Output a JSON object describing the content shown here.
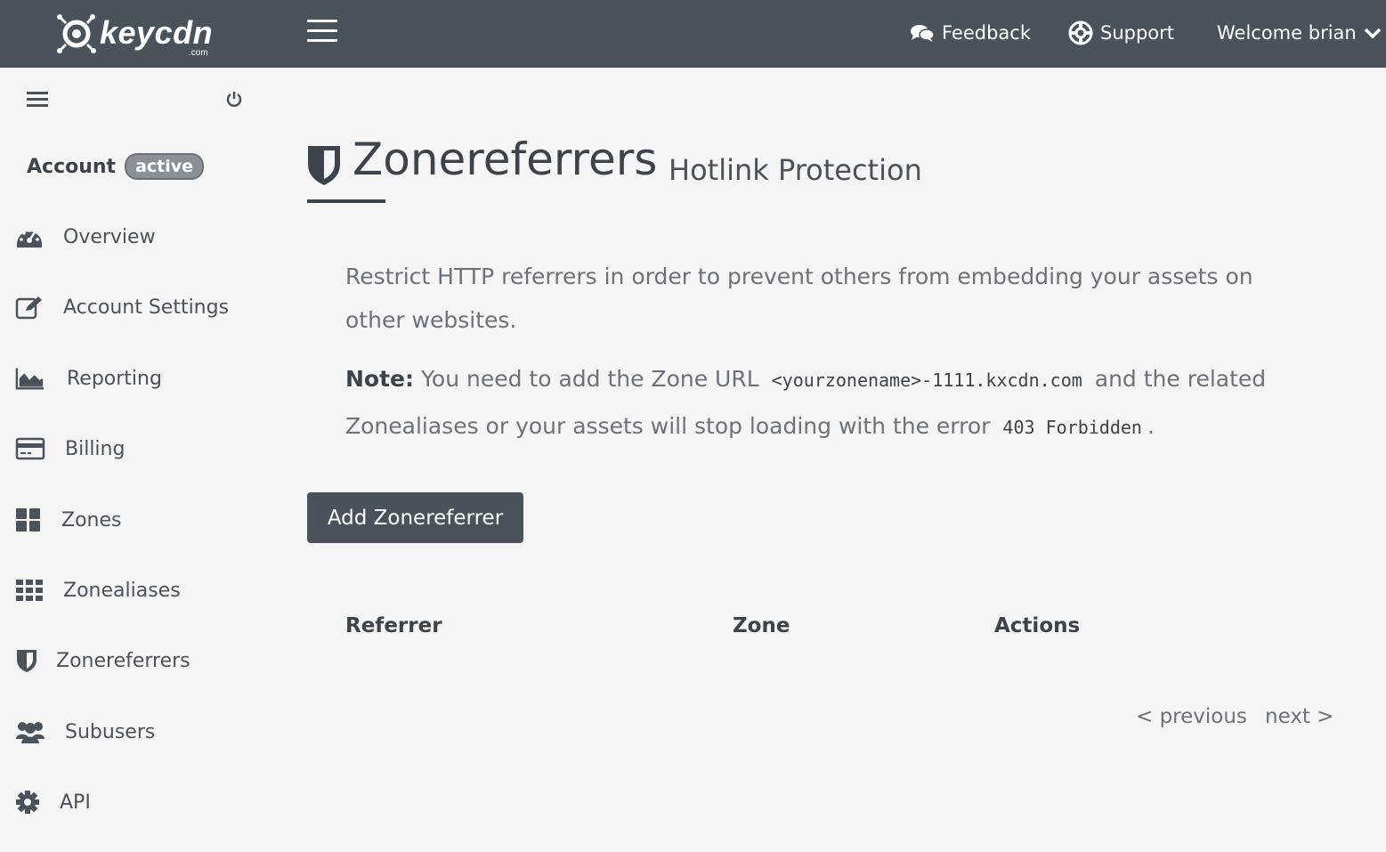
{
  "header": {
    "logo_text": "keycdn",
    "logo_sub": ".com",
    "menu_icon": "hamburger-icon",
    "feedback": "Feedback",
    "support": "Support",
    "welcome": "Welcome brian"
  },
  "sidebar": {
    "account_label": "Account",
    "account_badge": "active",
    "items": [
      {
        "label": "Overview",
        "icon": "dashboard-icon"
      },
      {
        "label": "Account Settings",
        "icon": "edit-icon"
      },
      {
        "label": "Reporting",
        "icon": "area-chart-icon"
      },
      {
        "label": "Billing",
        "icon": "credit-card-icon"
      },
      {
        "label": "Zones",
        "icon": "grid-icon"
      },
      {
        "label": "Zonealiases",
        "icon": "grid-small-icon"
      },
      {
        "label": "Zonereferrers",
        "icon": "shield-icon"
      },
      {
        "label": "Subusers",
        "icon": "users-icon"
      },
      {
        "label": "API",
        "icon": "gear-icon"
      }
    ]
  },
  "page": {
    "title": "Zonereferrers",
    "subtitle": "Hotlink Protection",
    "description": "Restrict HTTP referrers in order to prevent others from embedding your assets on other websites.",
    "note_label": "Note:",
    "note_text_1": "You need to add the Zone URL",
    "note_code_1": "<yourzonename>-1111.kxcdn.com",
    "note_text_2": "and the related Zonealiases or your assets will stop loading with the error",
    "note_code_2": "403 Forbidden",
    "note_text_3": ".",
    "add_button": "Add Zonereferrer",
    "columns": [
      "Referrer",
      "Zone",
      "Actions"
    ],
    "pager_prev": "< previous",
    "pager_next": "next >"
  },
  "colors": {
    "topbar": "#4a525c",
    "background": "#f5f5f5",
    "text": "#4a525c"
  }
}
